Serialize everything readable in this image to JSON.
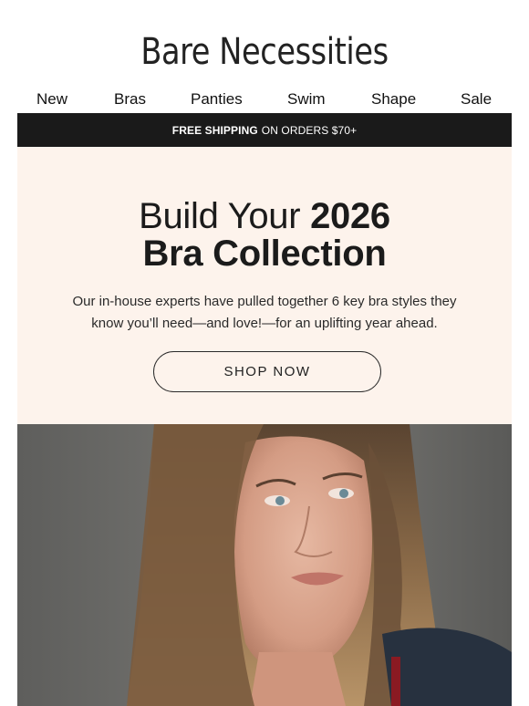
{
  "brand": {
    "name": "Bare Necessities"
  },
  "nav": {
    "items": [
      "New",
      "Bras",
      "Panties",
      "Swim",
      "Shape",
      "Sale"
    ]
  },
  "shipping": {
    "bold": "FREE SHIPPING",
    "rest": "ON ORDERS $70+"
  },
  "hero": {
    "line1_light": "Build Your ",
    "line1_bold": "2026",
    "line2_bold": "Bra Collection",
    "body_line1": "Our in-house experts have pulled together 6 key bra styles they",
    "body_line2": "know you’ll need—and love!—for an uplifting year ahead.",
    "cta": "SHOP NOW",
    "background": "#fdf3ec"
  },
  "colors": {
    "bar": "#1a1a1a",
    "text": "#111111"
  },
  "image": {
    "subject": "model-portrait-photo"
  }
}
